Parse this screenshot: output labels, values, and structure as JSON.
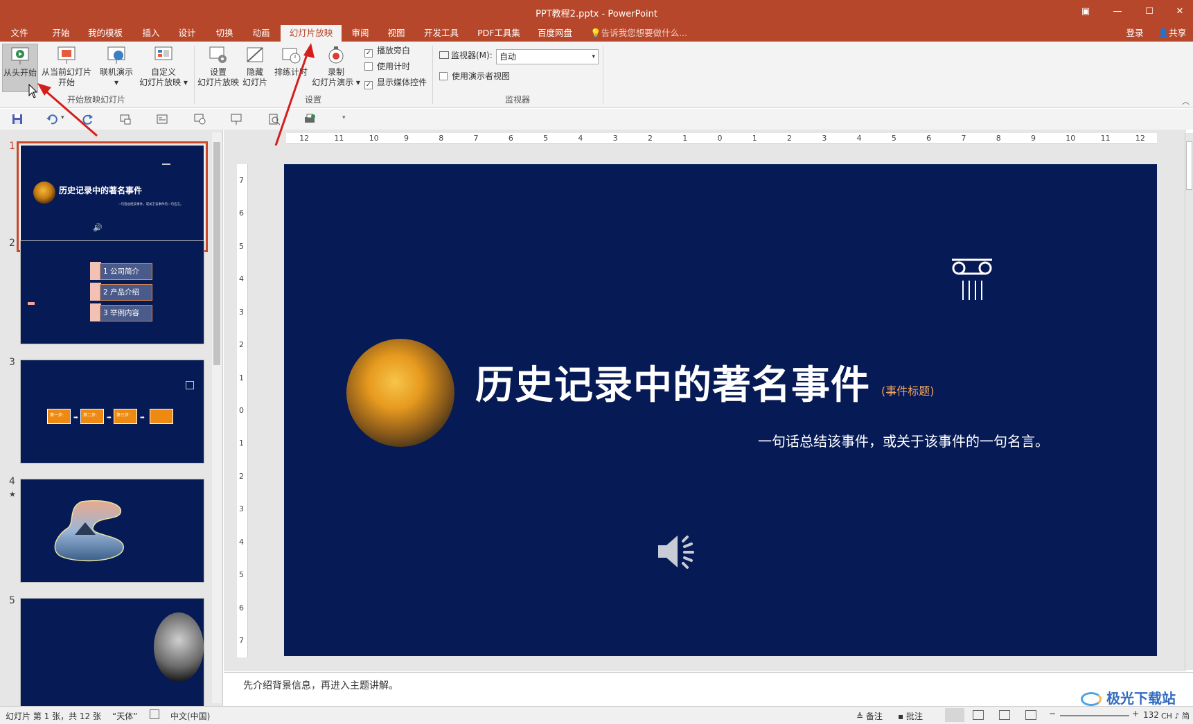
{
  "window": {
    "title": "PPT教程2.pptx - PowerPoint",
    "btn_ribbon": "▣",
    "btn_min": "—",
    "btn_max": "☐",
    "btn_close": "✕"
  },
  "tabs": [
    "文件",
    "开始",
    "我的模板",
    "插入",
    "设计",
    "切换",
    "动画",
    "幻灯片放映",
    "审阅",
    "视图",
    "开发工具",
    "PDF工具集",
    "百度网盘"
  ],
  "active_tab": "幻灯片放映",
  "tell_me": "告诉我您想要做什么...",
  "login": "登录",
  "share": "共享",
  "ribbon": {
    "from_start": "从头开始",
    "from_current_1": "从当前幻灯片",
    "from_current_2": "开始",
    "online_1": "联机演示",
    "online_2": "▾",
    "custom_1": "自定义",
    "custom_2": "幻灯片放映 ▾",
    "group_start": "开始放映幻灯片",
    "setup_1": "设置",
    "setup_2": "幻灯片放映",
    "hide_1": "隐藏",
    "hide_2": "幻灯片",
    "rehearse": "排练计时",
    "record_1": "录制",
    "record_2": "幻灯片演示 ▾",
    "play_narration": "播放旁白",
    "use_timings": "使用计时",
    "show_media": "显示媒体控件",
    "group_setup": "设置",
    "monitor_label": "监视器(M):",
    "monitor_value": "自动",
    "presenter_view": "使用演示者视图",
    "group_monitor": "监视器"
  },
  "thumbnails": [
    {
      "num": "1",
      "title": "历史记录中的著名事件",
      "subtitle": "一句话总结该事件，或关于该事件的一句名言。"
    },
    {
      "num": "2",
      "items": [
        "1 公司简介",
        "2 产品介绍",
        "3 举例内容"
      ]
    },
    {
      "num": "3",
      "steps": [
        "第一步:",
        "第二步:",
        "第三步:"
      ]
    },
    {
      "num": "4",
      "star": "★"
    },
    {
      "num": "5"
    }
  ],
  "slide": {
    "title": "历史记录中的著名事件",
    "title_tag": "(事件标题)",
    "subtitle": "一句话总结该事件，或关于该事件的一句名言。"
  },
  "ruler_h": [
    "12",
    "11",
    "10",
    "9",
    "8",
    "7",
    "6",
    "5",
    "4",
    "3",
    "2",
    "1",
    "0",
    "1",
    "2",
    "3",
    "4",
    "5",
    "6",
    "7",
    "8",
    "9",
    "10",
    "11",
    "12"
  ],
  "ruler_v": [
    "7",
    "6",
    "5",
    "4",
    "3",
    "2",
    "1",
    "0",
    "1",
    "2",
    "3",
    "4",
    "5",
    "6",
    "7"
  ],
  "notes": "先介绍背景信息，再进入主题讲解。",
  "status": {
    "slide_info": "幻灯片 第 1 张，共 12 张",
    "theme": "“天体”",
    "lang": "中文(中国)",
    "notes_btn": "备注",
    "comments_btn": "批注",
    "zoom": "132",
    "ime": "CH ♪ 简"
  },
  "watermark": "极光下载站",
  "colors": {
    "accent": "#b7472a",
    "slide_bg": "#061a55",
    "orange": "#ee8a12",
    "annotation": "#d41e1e"
  }
}
